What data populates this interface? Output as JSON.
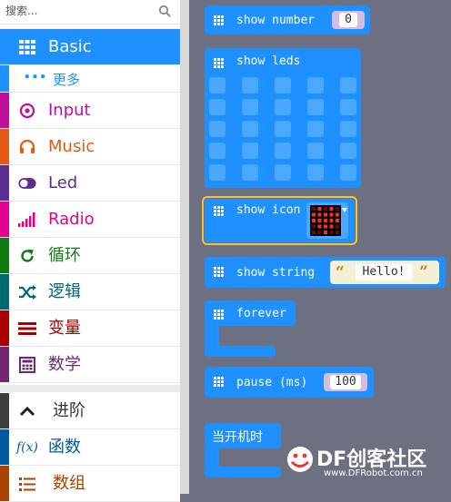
{
  "search": {
    "placeholder": "搜索..."
  },
  "categories": [
    {
      "label": "Basic",
      "color": "#1e90ff",
      "icon": "grid-icon"
    },
    {
      "label": "Input",
      "color": "#c10e9d",
      "icon": "target-icon"
    },
    {
      "label": "Music",
      "color": "#e25a14",
      "icon": "headphones-icon"
    },
    {
      "label": "Led",
      "color": "#5c2d91",
      "icon": "toggle-icon"
    },
    {
      "label": "Radio",
      "color": "#e3008c",
      "icon": "signal-icon"
    },
    {
      "label": "循环",
      "color": "#107c10",
      "icon": "loop-icon"
    },
    {
      "label": "逻辑",
      "color": "#006970",
      "icon": "shuffle-icon"
    },
    {
      "label": "变量",
      "color": "#a80000",
      "icon": "variables-icon"
    },
    {
      "label": "数学",
      "color": "#712672",
      "icon": "calculator-icon"
    },
    {
      "label": "进阶",
      "color": "#3c3c3c",
      "icon": "chevron-up-icon"
    },
    {
      "label": "函数",
      "color": "#005a9e",
      "icon": "function-icon"
    },
    {
      "label": "数组",
      "color": "#a94400",
      "icon": "list-icon"
    }
  ],
  "subcategory": {
    "label": "更多",
    "icon": "more-dots-icon"
  },
  "blocks": {
    "show_number": {
      "label": "show number",
      "value": "0"
    },
    "show_leds": {
      "label": "show leds"
    },
    "show_icon": {
      "label": "show icon"
    },
    "show_string": {
      "label": "show string",
      "value": "Hello!"
    },
    "forever": {
      "label": "forever"
    },
    "pause": {
      "label": "pause (ms)",
      "value": "100"
    },
    "on_start": {
      "label": "当开机时"
    }
  },
  "watermark": {
    "brand": "DF创客社区",
    "url": "www.DFRobot.com.cn"
  }
}
